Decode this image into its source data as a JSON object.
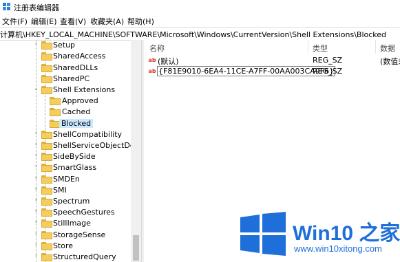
{
  "window": {
    "title": "注册表编辑器"
  },
  "menu": [
    "文件(F)",
    "编辑(E)",
    "查看(V)",
    "收藏夹(A)",
    "帮助(H)"
  ],
  "address": "计算机\\HKEY_LOCAL_MACHINE\\SOFTWARE\\Microsoft\\Windows\\CurrentVersion\\Shell Extensions\\Blocked",
  "tree": [
    {
      "label": "Setup",
      "expander": "›"
    },
    {
      "label": "SharedAccess",
      "expander": ""
    },
    {
      "label": "SharedDLLs",
      "expander": ""
    },
    {
      "label": "SharedPC",
      "expander": ""
    },
    {
      "label": "Shell Extensions",
      "expander": "⌄"
    },
    {
      "label": "Approved",
      "expander": ""
    },
    {
      "label": "Cached",
      "expander": ""
    },
    {
      "label": "Blocked",
      "expander": ""
    },
    {
      "label": "ShellCompatibility",
      "expander": "›"
    },
    {
      "label": "ShellServiceObjectDelayl",
      "expander": "›"
    },
    {
      "label": "SideBySide",
      "expander": "›"
    },
    {
      "label": "SmartGlass",
      "expander": "›"
    },
    {
      "label": "SMDEn",
      "expander": "›"
    },
    {
      "label": "SMI",
      "expander": "›"
    },
    {
      "label": "Spectrum",
      "expander": "›"
    },
    {
      "label": "SpeechGestures",
      "expander": "›"
    },
    {
      "label": "StillImage",
      "expander": "›"
    },
    {
      "label": "StorageSense",
      "expander": "›"
    },
    {
      "label": "Store",
      "expander": "›"
    },
    {
      "label": "StructuredQuery",
      "expander": "›"
    }
  ],
  "columns": {
    "name": "名称",
    "type": "类型",
    "data": "数据"
  },
  "values": [
    {
      "icon": "ab",
      "name": "(默认)",
      "type": "REG_SZ",
      "data": "(数值未"
    },
    {
      "icon": "ab",
      "name": "{F81E9010-6EA4-11CE-A7FF-00AA003CA9F6}",
      "type": "REG_SZ",
      "data": ""
    }
  ],
  "watermark": {
    "title": "Win10 之家",
    "url": "www.win10xitong.com"
  },
  "colors": {
    "selection": "#cce8ff",
    "folder": "#f5cd5a",
    "accent": "#1e6fd9",
    "string_icon": "#d23b2a"
  }
}
